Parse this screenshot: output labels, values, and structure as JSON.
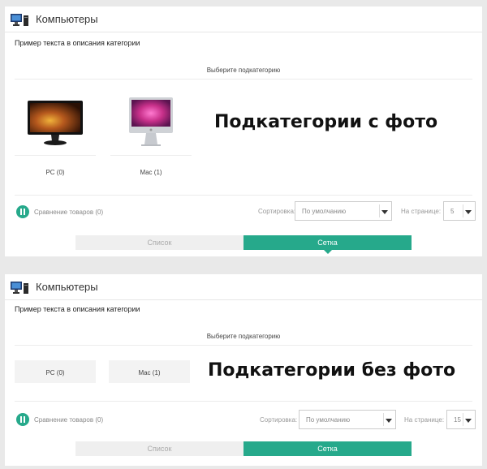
{
  "colors": {
    "accent": "#26a98b",
    "background": "#e9e9e9"
  },
  "panels": [
    {
      "header": {
        "title": "Компьютеры",
        "icon": "computer-icon"
      },
      "description": "Пример текста в описания категории",
      "choose_label": "Выберите подкатегорию",
      "overlay_caption": "Подкатегории с фото",
      "subcategories": [
        {
          "label": "PC (0)",
          "icon": "monitor-pc"
        },
        {
          "label": "Mac (1)",
          "icon": "imac"
        }
      ],
      "compare_label": "Сравнение товаров (0)",
      "sort_label": "Сортировка:",
      "sort_value": "По умолчанию",
      "per_page_label": "На странице:",
      "per_page_value": "5",
      "view_list": "Список",
      "view_grid": "Сетка"
    },
    {
      "header": {
        "title": "Компьютеры",
        "icon": "computer-icon"
      },
      "description": "Пример текста в описания категории",
      "choose_label": "Выберите подкатегорию",
      "overlay_caption": "Подкатегории без фото",
      "subcategories": [
        {
          "label": "PC (0)"
        },
        {
          "label": "Mac (1)"
        }
      ],
      "compare_label": "Сравнение товаров (0)",
      "sort_label": "Сортировка:",
      "sort_value": "По умолчанию",
      "per_page_label": "На странице:",
      "per_page_value": "15",
      "view_list": "Список",
      "view_grid": "Сетка"
    }
  ]
}
